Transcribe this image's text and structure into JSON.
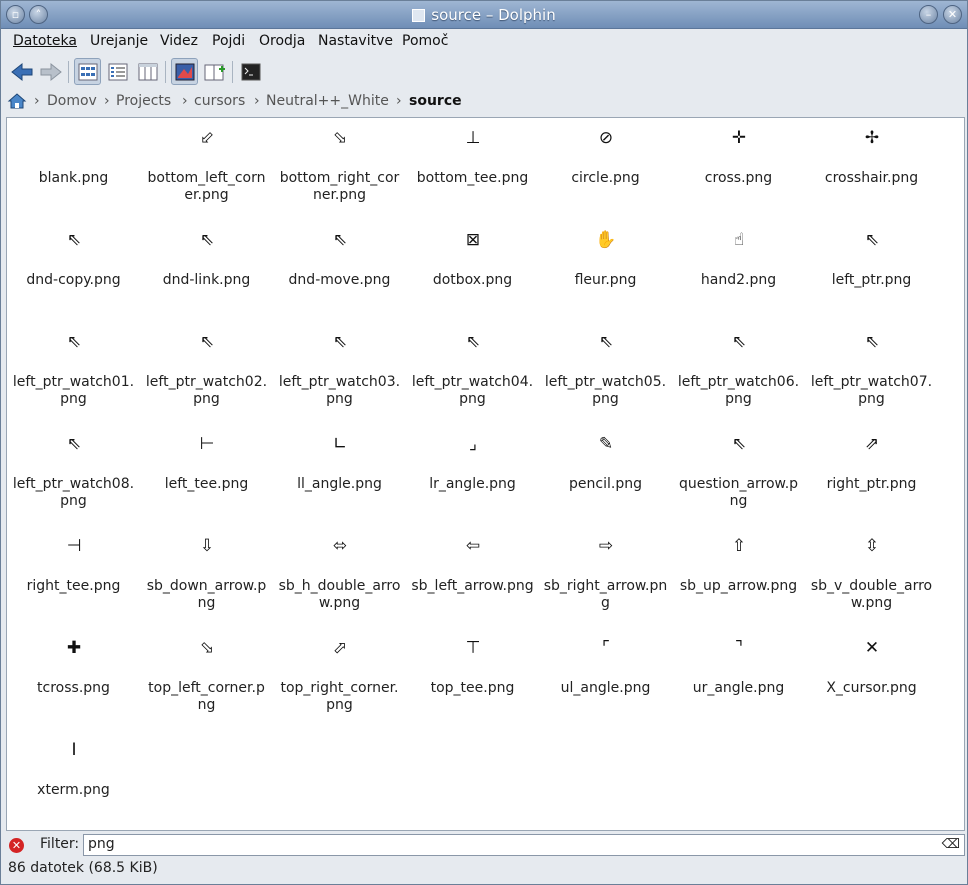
{
  "window": {
    "title": "source – Dolphin"
  },
  "menu": [
    "Datoteka",
    "Urejanje",
    "Videz",
    "Pojdi",
    "Orodja",
    "Nastavitve",
    "Pomoč"
  ],
  "toolbar": {
    "back": "back-arrow-icon",
    "forward": "forward-arrow-icon",
    "icons_view": "icons-view-icon",
    "details_view": "details-view-icon",
    "columns_view": "columns-view-icon",
    "preview": "preview-icon",
    "split": "split-view-icon",
    "terminal": "terminal-icon"
  },
  "breadcrumb": [
    "Domov",
    "Projects",
    "cursors",
    "Neutral++_White",
    "source"
  ],
  "files": [
    {
      "name": "blank.png",
      "glyph": ""
    },
    {
      "name": "bottom_left_corner.png",
      "glyph": "⬃"
    },
    {
      "name": "bottom_right_corner.png",
      "glyph": "⬂"
    },
    {
      "name": "bottom_tee.png",
      "glyph": "⊥"
    },
    {
      "name": "circle.png",
      "glyph": "⊘"
    },
    {
      "name": "cross.png",
      "glyph": "✛"
    },
    {
      "name": "crosshair.png",
      "glyph": "✢"
    },
    {
      "name": "dnd-copy.png",
      "glyph": "⇖"
    },
    {
      "name": "dnd-link.png",
      "glyph": "⇖"
    },
    {
      "name": "dnd-move.png",
      "glyph": "⇖"
    },
    {
      "name": "dotbox.png",
      "glyph": "⊠"
    },
    {
      "name": "fleur.png",
      "glyph": "✋"
    },
    {
      "name": "hand2.png",
      "glyph": "☝"
    },
    {
      "name": "left_ptr.png",
      "glyph": "⇖"
    },
    {
      "name": "left_ptr_watch01.png",
      "glyph": "⇖"
    },
    {
      "name": "left_ptr_watch02.png",
      "glyph": "⇖"
    },
    {
      "name": "left_ptr_watch03.png",
      "glyph": "⇖"
    },
    {
      "name": "left_ptr_watch04.png",
      "glyph": "⇖"
    },
    {
      "name": "left_ptr_watch05.png",
      "glyph": "⇖"
    },
    {
      "name": "left_ptr_watch06.png",
      "glyph": "⇖"
    },
    {
      "name": "left_ptr_watch07.png",
      "glyph": "⇖"
    },
    {
      "name": "left_ptr_watch08.png",
      "glyph": "⇖"
    },
    {
      "name": "left_tee.png",
      "glyph": "⊢"
    },
    {
      "name": "ll_angle.png",
      "glyph": "∟"
    },
    {
      "name": "lr_angle.png",
      "glyph": "⌟"
    },
    {
      "name": "pencil.png",
      "glyph": "✎"
    },
    {
      "name": "question_arrow.png",
      "glyph": "⇖"
    },
    {
      "name": "right_ptr.png",
      "glyph": "⇗"
    },
    {
      "name": "right_tee.png",
      "glyph": "⊣"
    },
    {
      "name": "sb_down_arrow.png",
      "glyph": "⇩"
    },
    {
      "name": "sb_h_double_arrow.png",
      "glyph": "⬄"
    },
    {
      "name": "sb_left_arrow.png",
      "glyph": "⇦"
    },
    {
      "name": "sb_right_arrow.png",
      "glyph": "⇨"
    },
    {
      "name": "sb_up_arrow.png",
      "glyph": "⇧"
    },
    {
      "name": "sb_v_double_arrow.png",
      "glyph": "⇳"
    },
    {
      "name": "tcross.png",
      "glyph": "✚"
    },
    {
      "name": "top_left_corner.png",
      "glyph": "⬂"
    },
    {
      "name": "top_right_corner.png",
      "glyph": "⬀"
    },
    {
      "name": "top_tee.png",
      "glyph": "⊤"
    },
    {
      "name": "ul_angle.png",
      "glyph": "⌜"
    },
    {
      "name": "ur_angle.png",
      "glyph": "⌝"
    },
    {
      "name": "X_cursor.png",
      "glyph": "✕"
    },
    {
      "name": "xterm.png",
      "glyph": "I"
    }
  ],
  "filter": {
    "label": "Filter:",
    "value": "png",
    "clear_icon": "clear-filter-icon",
    "close_icon": "close-filter-icon"
  },
  "status": "86 datotek (68.5 KiB)"
}
